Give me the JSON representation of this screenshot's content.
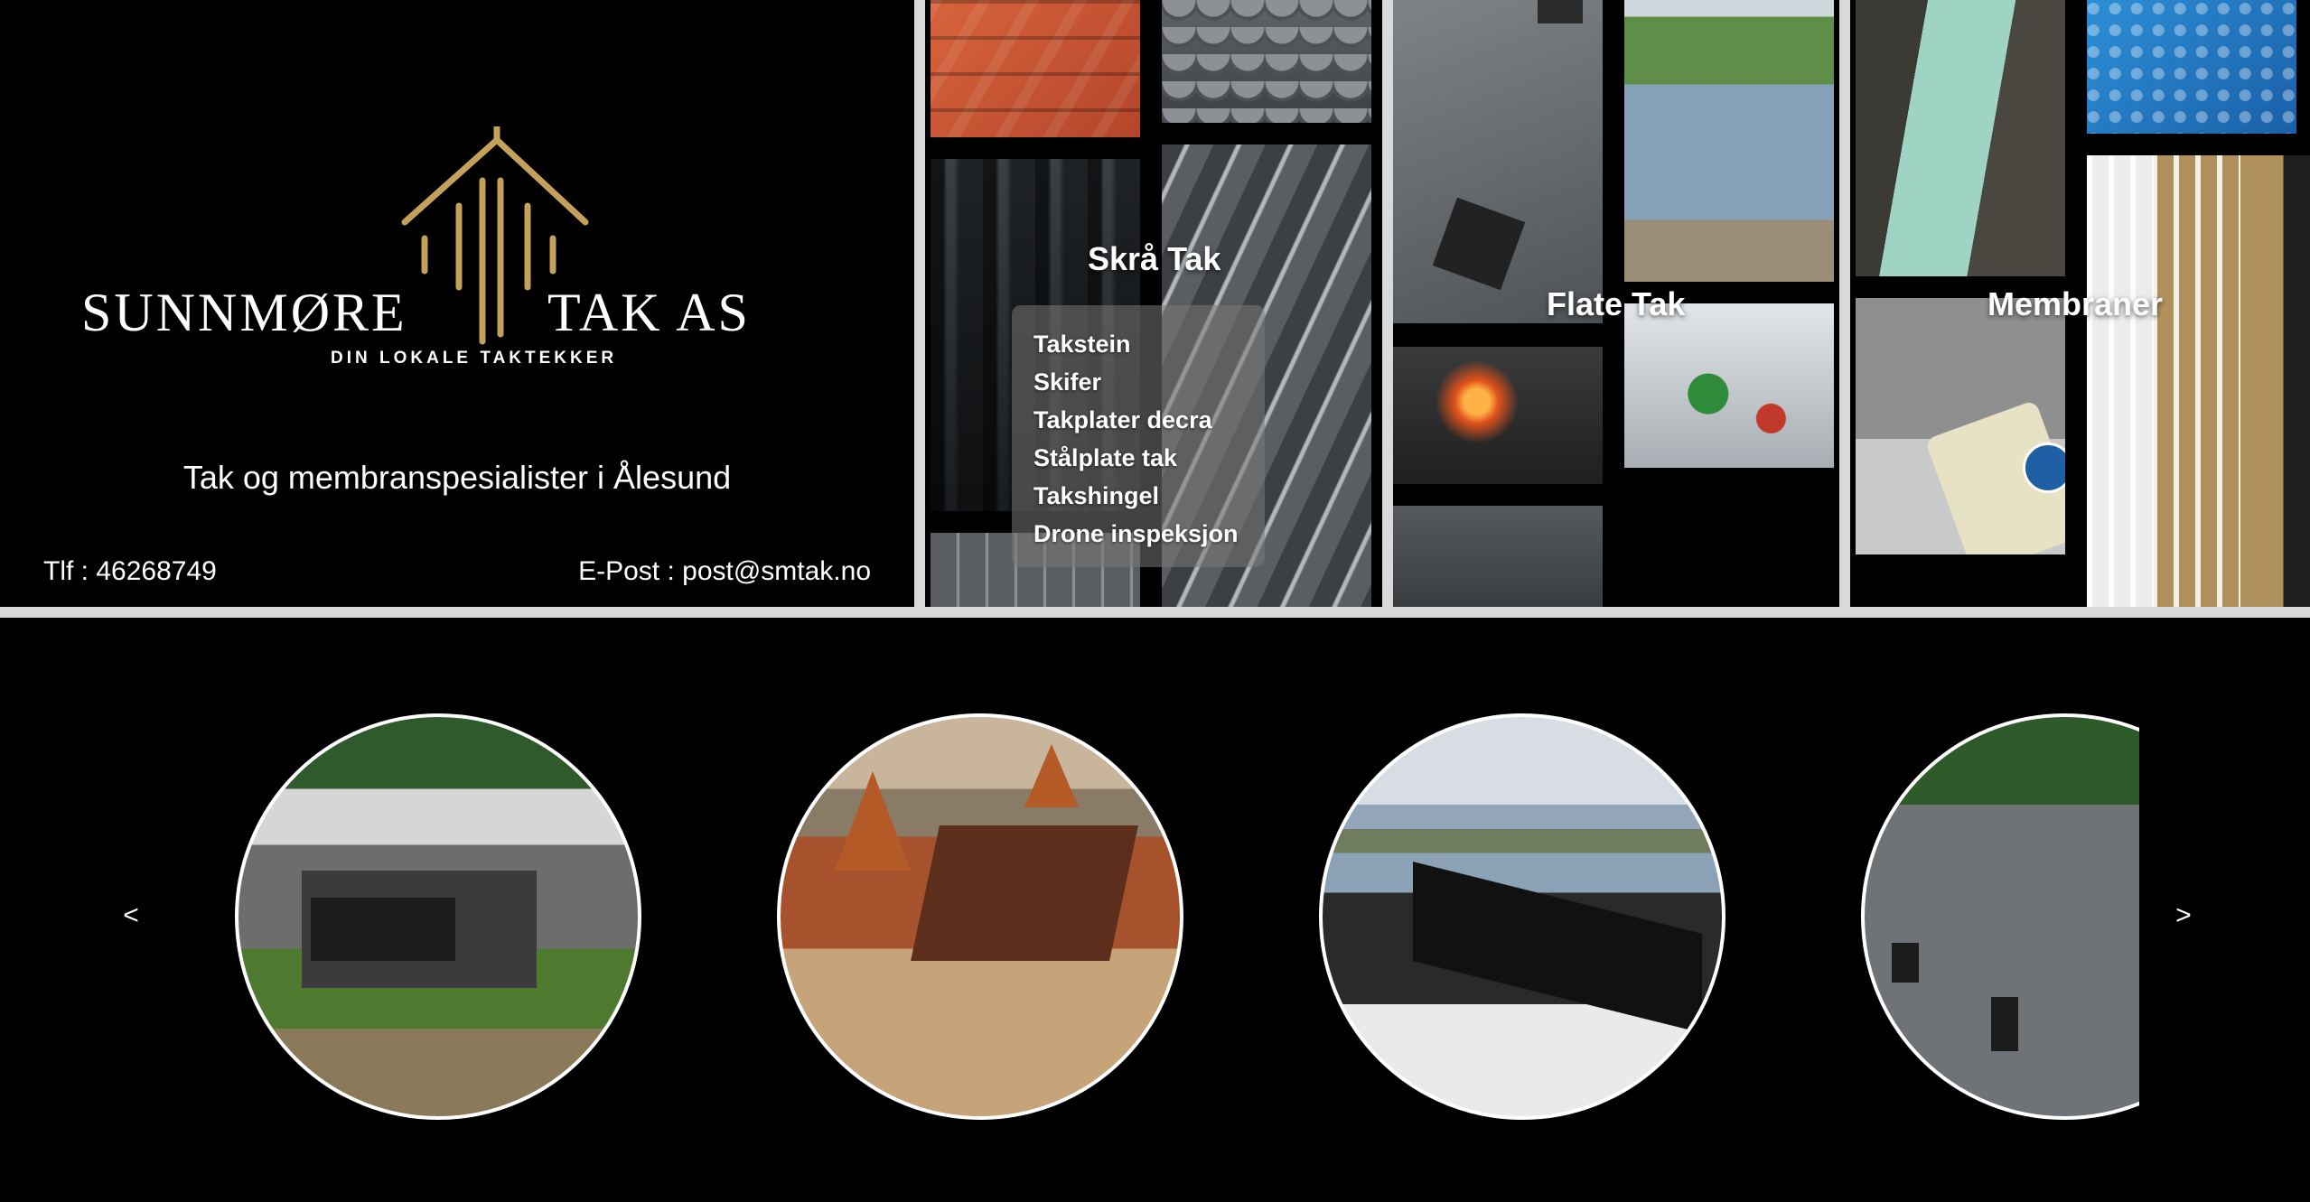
{
  "brand": {
    "name_left": "SUNNMØRE",
    "name_right": "TAK AS",
    "tagline": "DIN LOKALE TAKTEKKER",
    "slogan": "Tak og membranspesialister i Ålesund",
    "phone": "Tlf : 46268749",
    "email": "E-Post : post@smtak.no",
    "accent_color": "#c4a15a"
  },
  "categories": [
    {
      "title": "Skrå Tak",
      "items": [
        "Takstein",
        "Skifer",
        "Takplater decra",
        "Stålplate tak",
        "Takshingel",
        "Drone inspeksjon"
      ]
    },
    {
      "title": "Flate Tak"
    },
    {
      "title": "Membraner"
    }
  ],
  "carousel": {
    "prev_label": "<",
    "next_label": ">"
  }
}
